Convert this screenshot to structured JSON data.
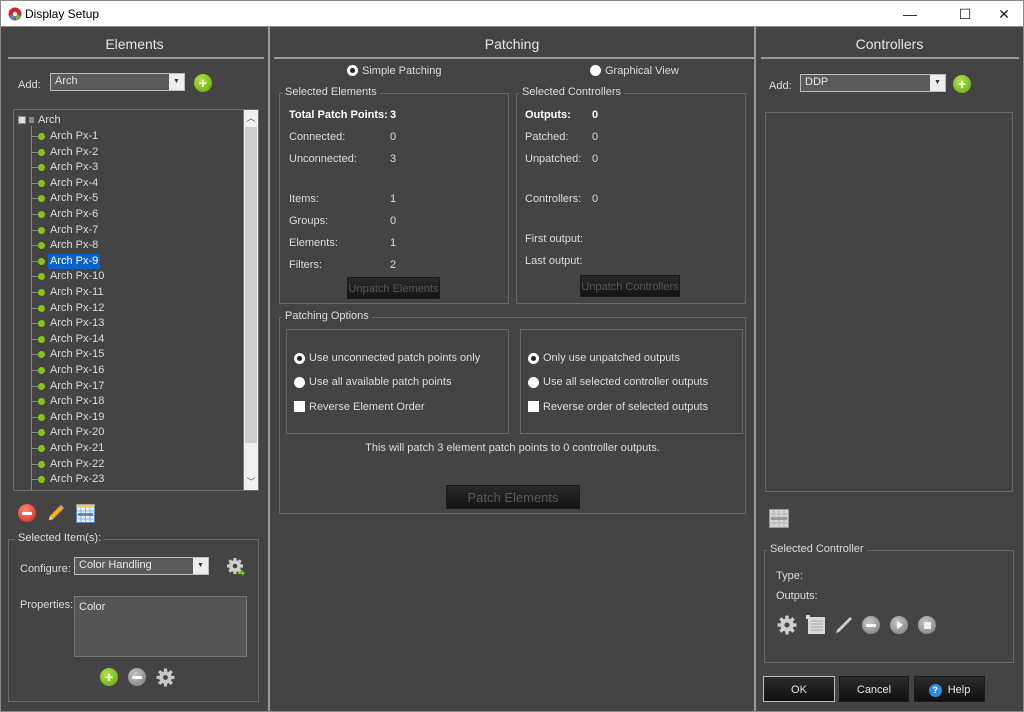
{
  "window": {
    "title": "Display Setup",
    "controls": {
      "minimize": "—",
      "maximize": "☐",
      "close": "✕"
    }
  },
  "elements_panel": {
    "title": "Elements",
    "add_label": "Add:",
    "add_value": "Arch",
    "tree": {
      "root": "Arch",
      "items": [
        "Arch Px-1",
        "Arch Px-2",
        "Arch Px-3",
        "Arch Px-4",
        "Arch Px-5",
        "Arch Px-6",
        "Arch Px-7",
        "Arch Px-8",
        "Arch Px-9",
        "Arch Px-10",
        "Arch Px-11",
        "Arch Px-12",
        "Arch Px-13",
        "Arch Px-14",
        "Arch Px-15",
        "Arch Px-16",
        "Arch Px-17",
        "Arch Px-18",
        "Arch Px-19",
        "Arch Px-20",
        "Arch Px-21",
        "Arch Px-22",
        "Arch Px-23"
      ],
      "selected": "Arch Px-9"
    },
    "toolbar_icons": [
      "delete-icon",
      "edit-pencil-icon",
      "grid-table-icon"
    ],
    "selected_items": {
      "title": "Selected Item(s):",
      "configure_label": "Configure:",
      "configure_value": "Color Handling",
      "properties_label": "Properties:",
      "properties": [
        "Color"
      ]
    }
  },
  "patching_panel": {
    "title": "Patching",
    "modes": [
      {
        "label": "Simple Patching",
        "checked": true
      },
      {
        "label": "Graphical View",
        "checked": false
      }
    ],
    "selected_elements": {
      "title": "Selected Elements",
      "rows": [
        {
          "label": "Total Patch Points:",
          "value": "3",
          "bold": true
        },
        {
          "label": "Connected:",
          "value": "0"
        },
        {
          "label": "Unconnected:",
          "value": "3"
        },
        {
          "label": "Items:",
          "value": "1"
        },
        {
          "label": "Groups:",
          "value": "0"
        },
        {
          "label": "Elements:",
          "value": "1"
        },
        {
          "label": "Filters:",
          "value": "2"
        }
      ],
      "button": "Unpatch Elements"
    },
    "selected_controllers": {
      "title": "Selected Controllers",
      "rows": [
        {
          "label": "Outputs:",
          "value": "0",
          "bold": true
        },
        {
          "label": "Patched:",
          "value": "0"
        },
        {
          "label": "Unpatched:",
          "value": "0"
        },
        {
          "label": "Controllers:",
          "value": "0"
        },
        {
          "label": "First output:",
          "value": ""
        },
        {
          "label": "Last output:",
          "value": ""
        }
      ],
      "button": "Unpatch Controllers"
    },
    "options": {
      "title": "Patching Options",
      "left": [
        {
          "type": "radio",
          "label": "Use unconnected patch points only",
          "checked": true
        },
        {
          "type": "radio",
          "label": "Use all available patch points",
          "checked": false
        },
        {
          "type": "checkbox",
          "label": "Reverse Element Order",
          "checked": false
        }
      ],
      "right": [
        {
          "type": "radio",
          "label": "Only use unpatched outputs",
          "checked": true
        },
        {
          "type": "radio",
          "label": "Use all selected controller outputs",
          "checked": false
        },
        {
          "type": "checkbox",
          "label": "Reverse order of selected outputs",
          "checked": false
        }
      ],
      "summary": "This will patch 3 element patch points to 0 controller outputs.",
      "button": "Patch Elements"
    }
  },
  "controllers_panel": {
    "title": "Controllers",
    "add_label": "Add:",
    "add_value": "DDP",
    "selected_controller": {
      "title": "Selected Controller",
      "type_label": "Type:",
      "outputs_label": "Outputs:",
      "icons": [
        "gear-icon",
        "list-icon",
        "pencil-icon",
        "remove-icon",
        "play-icon",
        "stop-icon"
      ]
    }
  },
  "footer": {
    "ok": "OK",
    "cancel": "Cancel",
    "help": "Help"
  },
  "colors": {
    "background": "#444444",
    "accent_green": "#86c41a",
    "selection_blue": "#0a64c8"
  }
}
